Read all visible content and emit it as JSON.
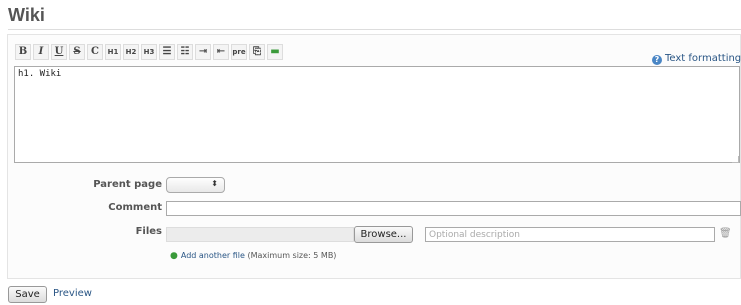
{
  "page": {
    "title": "Wiki"
  },
  "toolbar": {
    "buttons": [
      {
        "label": "B"
      },
      {
        "label": "I"
      },
      {
        "label": "U"
      },
      {
        "label": "S"
      },
      {
        "label": "C"
      },
      {
        "label": "H1"
      },
      {
        "label": "H2"
      },
      {
        "label": "H3"
      },
      {
        "label": ""
      },
      {
        "label": ""
      },
      {
        "label": ""
      },
      {
        "label": ""
      },
      {
        "label": "pre"
      },
      {
        "label": ""
      },
      {
        "label": ""
      }
    ],
    "icons": [
      "bold-icon",
      "italic-icon",
      "underline-icon",
      "strikethrough-icon",
      "code-icon",
      "heading1-icon",
      "heading2-icon",
      "heading3-icon",
      "unordered-list-icon",
      "ordered-list-icon",
      "quote-icon",
      "unquote-icon",
      "preformatted-icon",
      "link-icon",
      "image-icon"
    ],
    "help_label": "Text formatting"
  },
  "editor": {
    "content": "h1. Wiki"
  },
  "form": {
    "parent_page_label": "Parent page",
    "comment_label": "Comment",
    "comment_value": "",
    "files_label": "Files",
    "browse_label": "Browse...",
    "description_placeholder": "Optional description",
    "add_file_label": "Add another file",
    "max_size": "(Maximum size: 5 MB)"
  },
  "actions": {
    "save_label": "Save",
    "preview_label": "Preview"
  }
}
